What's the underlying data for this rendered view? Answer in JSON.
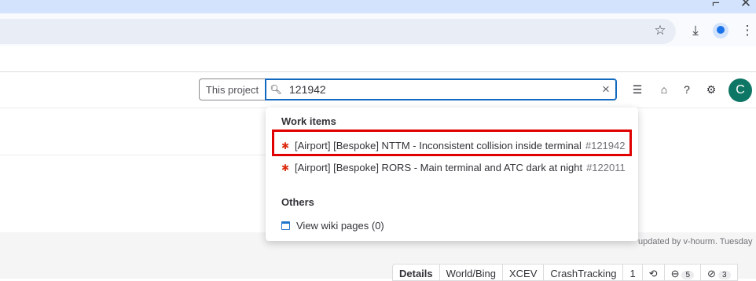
{
  "browser": {
    "star_icon": "star-icon",
    "download_icon": "download-icon",
    "menu_icon": "more-vert-icon",
    "window_controls": [
      "minimize-icon",
      "close-icon"
    ]
  },
  "search": {
    "scope_label": "This project",
    "query": "121942"
  },
  "header": {
    "avatar_initial": "C",
    "avatar_color": "#0e7664"
  },
  "dropdown": {
    "work_items_title": "Work items",
    "work_items": [
      {
        "title": "[Airport] [Bespoke] NTTM - Inconsistent collision inside terminal",
        "iid": "#121942"
      },
      {
        "title": "[Airport] [Bespoke] RORS - Main terminal and ATC dark at night",
        "iid": "#122011"
      }
    ],
    "others_title": "Others",
    "others": [
      {
        "label": "View wiki pages (0)"
      }
    ]
  },
  "page": {
    "updated_text": "updated by v-hourm. Tuesday"
  },
  "tabs": [
    {
      "label": "Details"
    },
    {
      "label": "World/Bing"
    },
    {
      "label": "XCEV"
    },
    {
      "label": "CrashTracking"
    },
    {
      "label": "1"
    },
    {
      "label": "",
      "count": ""
    },
    {
      "label": "",
      "count": "5"
    },
    {
      "label": "",
      "count": "3"
    }
  ],
  "colors": {
    "highlight": "#e00000",
    "accent": "#1068bf",
    "bug": "#dd2b0e"
  }
}
